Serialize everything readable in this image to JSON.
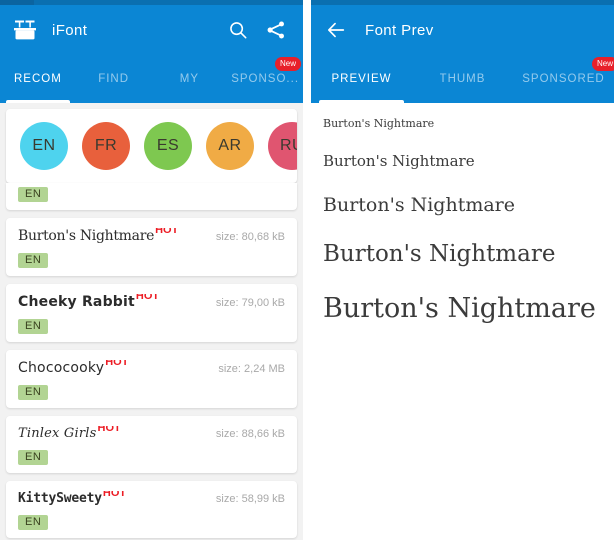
{
  "left": {
    "appbar": {
      "logo_icon": "ifont-logo-icon",
      "title": "iFont",
      "search_icon": "search-icon",
      "share_icon": "share-icon"
    },
    "tabs": [
      {
        "label": "RECOM",
        "active": true,
        "badge": ""
      },
      {
        "label": "FIND",
        "active": false,
        "badge": ""
      },
      {
        "label": "MY",
        "active": false,
        "badge": ""
      },
      {
        "label": "SPONSO...",
        "active": false,
        "badge": "New"
      }
    ],
    "language_chips": [
      {
        "label": "EN",
        "color": "#4ed3ee"
      },
      {
        "label": "FR",
        "color": "#e8603c"
      },
      {
        "label": "ES",
        "color": "#7ec850"
      },
      {
        "label": "AR",
        "color": "#f0ab45"
      },
      {
        "label": "RU",
        "color": "#e05570"
      }
    ],
    "partial_card": {
      "lang": "EN"
    },
    "font_items": [
      {
        "name": "Burton's Nightmare",
        "hot": "HOT",
        "size": "size: 80,68 kB",
        "lang": "EN",
        "style": "n1"
      },
      {
        "name": "Cheeky Rabbit",
        "hot": "HOT",
        "size": "size: 79,00 kB",
        "lang": "EN",
        "style": "n2"
      },
      {
        "name": "Chococooky",
        "hot": "HOT",
        "size": "size: 2,24 MB",
        "lang": "EN",
        "style": "n3"
      },
      {
        "name": "Tinlex Girls",
        "hot": "HOT",
        "size": "size: 88,66 kB",
        "lang": "EN",
        "style": "n4"
      },
      {
        "name": "KittySweety",
        "hot": "HOT",
        "size": "size: 58,99 kB",
        "lang": "EN",
        "style": "n5"
      }
    ]
  },
  "right": {
    "appbar": {
      "back_icon": "back-arrow-icon",
      "title": "Font Prev"
    },
    "tabs": [
      {
        "label": "PREVIEW",
        "active": true,
        "badge": ""
      },
      {
        "label": "THUMB",
        "active": false,
        "badge": ""
      },
      {
        "label": "SPONSORED",
        "active": false,
        "badge": "New"
      }
    ],
    "preview_lines": [
      "Burton's Nightmare",
      "Burton's Nightmare",
      "Burton's Nightmare",
      "Burton's Nightmare",
      "Burton's Nightmare"
    ]
  },
  "colors": {
    "app_blue": "#0b86d4",
    "status_blue": "#0a6fb0",
    "hot_red": "#ec1c24",
    "badge_red": "#e8202a",
    "lang_badge_green": "#b2d493",
    "list_background": "#f2f2f2"
  }
}
